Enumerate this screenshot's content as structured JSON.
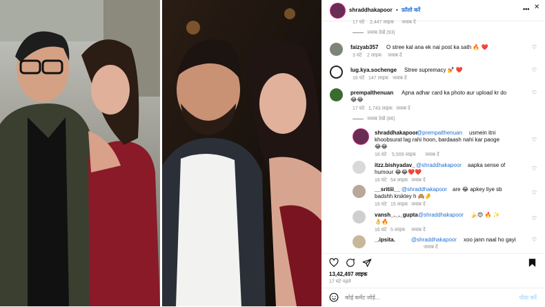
{
  "header": {
    "username": "shraddhakapoor",
    "follow_label": "फ़ॉलो करें",
    "more_label": "•••",
    "close_label": "✕"
  },
  "comments": [
    {
      "meta_time": "17 घंटे",
      "meta_likes": "2,447 लाइक",
      "meta_reply": "जवाब दें",
      "view_replies": "जवाब देखें (93)"
    },
    {
      "username": "faizyab357",
      "text": "O stree kal ana ek nai post ka sath 🔥 ❤️",
      "time": "3 घंटे",
      "likes": "2 लाइक",
      "reply": "जवाब दें"
    },
    {
      "username": "lug.kya.sochenge",
      "text": "Stree supremacy 💅 ❤️",
      "time": "16 घंटे",
      "likes": "147 लाइक",
      "reply": "जवाब दें"
    },
    {
      "username": "prempalthenuan",
      "text": "Apna adhar card ka photo aur upload kr do",
      "text2": "😂😂",
      "time": "17 घंटे",
      "likes": "1,743 लाइक",
      "reply": "जवाब दें",
      "view_replies": "जवाब देखें (86)"
    }
  ],
  "replies": [
    {
      "username": "shraddhakapoor",
      "mention": "@prempalthenuan",
      "text": "usmein itni",
      "text2": "khoobsurat lag rahi hoon, bardaash nahi kar paoge",
      "text3": "😂😂",
      "time": "16 घंटे",
      "likes": "5,509 लाइक",
      "reply": "जवाब दें"
    },
    {
      "username": "itzz.bishyadav_",
      "mention": "@shraddhakapoor",
      "text": "aapka sense of",
      "text2": "humour 😂😂❤️❤️",
      "time": "16 घंटे",
      "likes": "54 लाइक",
      "reply": "जवाब दें"
    },
    {
      "username": "__sritiii__",
      "mention": "@shraddhakapoor",
      "text": "are 😂 apkey liye sb",
      "text2": "badshh krsktey h 🙈🤌",
      "time": "16 घंटे",
      "likes": "15 लाइक",
      "reply": "जवाब दें"
    },
    {
      "username": "vansh_._._gupta",
      "mention": "@shraddhakapoor",
      "text": "🍌😍 🔥 ✨",
      "text2": "👌🔥",
      "time": "16 घंटे",
      "likes": "5 लाइक",
      "reply": "जवाब दें"
    },
    {
      "username": "_.ipsita.",
      "mention": "@shraddhakapoor",
      "text": "xoo jann naal ho gayi",
      "time": "",
      "likes": "",
      "reply": "जवाब दें"
    }
  ],
  "post": {
    "likes": "13,42,497 लाइक",
    "time": "17 घंटे पहले",
    "comment_placeholder": "कोई कमेंट जोड़ें...",
    "post_label": "पोस्ट करें"
  },
  "colors": {
    "link_blue": "#1f6fd6",
    "heart_red": "#ed4956",
    "divider": "#efefef",
    "meta_grey": "#8e8e8e"
  }
}
